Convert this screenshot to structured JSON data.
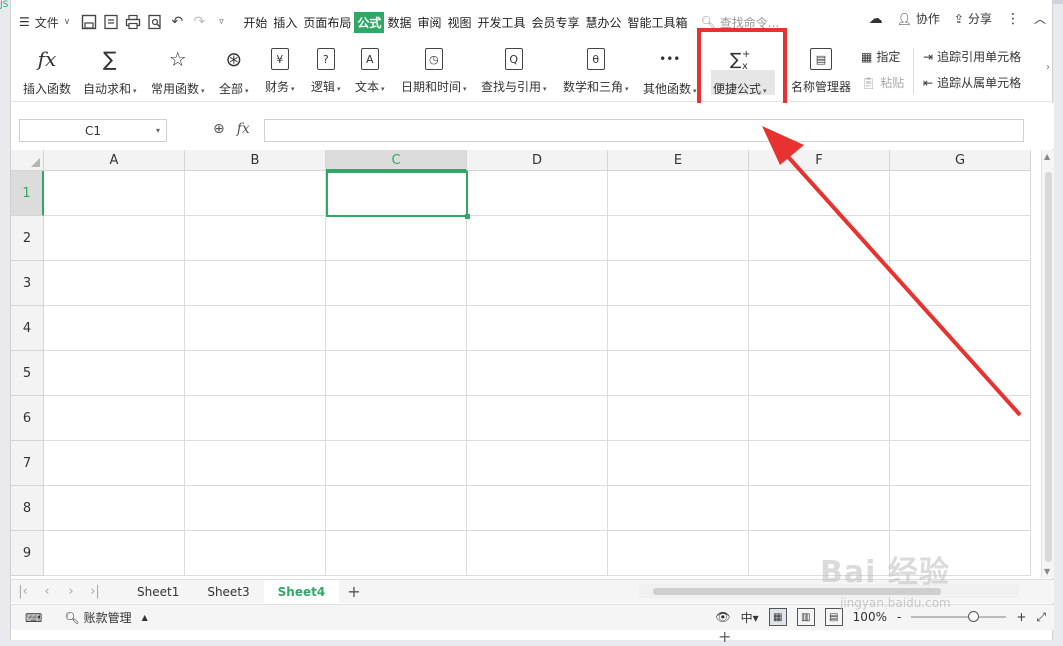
{
  "menubar": {
    "file_label": "文件",
    "tabs": [
      {
        "label": "开始"
      },
      {
        "label": "插入"
      },
      {
        "label": "页面布局"
      },
      {
        "label": "公式"
      },
      {
        "label": "数据"
      },
      {
        "label": "审阅"
      },
      {
        "label": "视图"
      },
      {
        "label": "开发工具"
      },
      {
        "label": "会员专享"
      },
      {
        "label": "慧办公"
      },
      {
        "label": "智能工具箱"
      }
    ],
    "search_placeholder": "查找命令...",
    "collab_label": "协作",
    "share_label": "分享"
  },
  "ribbon": {
    "insert_function": "插入函数",
    "autosum": "自动求和",
    "common_functions": "常用函数",
    "all": "全部",
    "finance": "财务",
    "logic": "逻辑",
    "text": "文本",
    "datetime": "日期和时间",
    "lookup": "查找与引用",
    "math": "数学和三角",
    "other": "其他函数",
    "quick_formula": "便捷公式",
    "name_manager": "名称管理器",
    "define": "指定",
    "paste": "粘贴",
    "trace_precedents": "追踪引用单元格",
    "trace_dependents": "追踪从属单元格",
    "icon_glyphs": {
      "finance": "¥",
      "logic": "?",
      "text": "A",
      "lookup": "Q",
      "math": "θ",
      "other": "•••"
    }
  },
  "formula_bar": {
    "name_box": "C1",
    "fx_label": "fx",
    "formula_value": ""
  },
  "grid": {
    "columns": [
      "A",
      "B",
      "C",
      "D",
      "E",
      "F",
      "G"
    ],
    "rows": [
      "1",
      "2",
      "3",
      "4",
      "5",
      "6",
      "7",
      "8",
      "9"
    ],
    "selected_column": "C",
    "selected_row": "1"
  },
  "sheets": {
    "tabs": [
      {
        "label": "Sheet1"
      },
      {
        "label": "Sheet3"
      },
      {
        "label": "Sheet4"
      }
    ],
    "active": "Sheet4",
    "add": "+"
  },
  "statusbar": {
    "account": "账款管理",
    "zoom": "100%",
    "zoom_minus": "-",
    "zoom_plus": "+"
  },
  "watermark": {
    "brand": "Bai 经验",
    "url": "jingyan.baidu.com"
  },
  "colors": {
    "accent": "#2fa866",
    "highlight_box": "#e8322f"
  }
}
